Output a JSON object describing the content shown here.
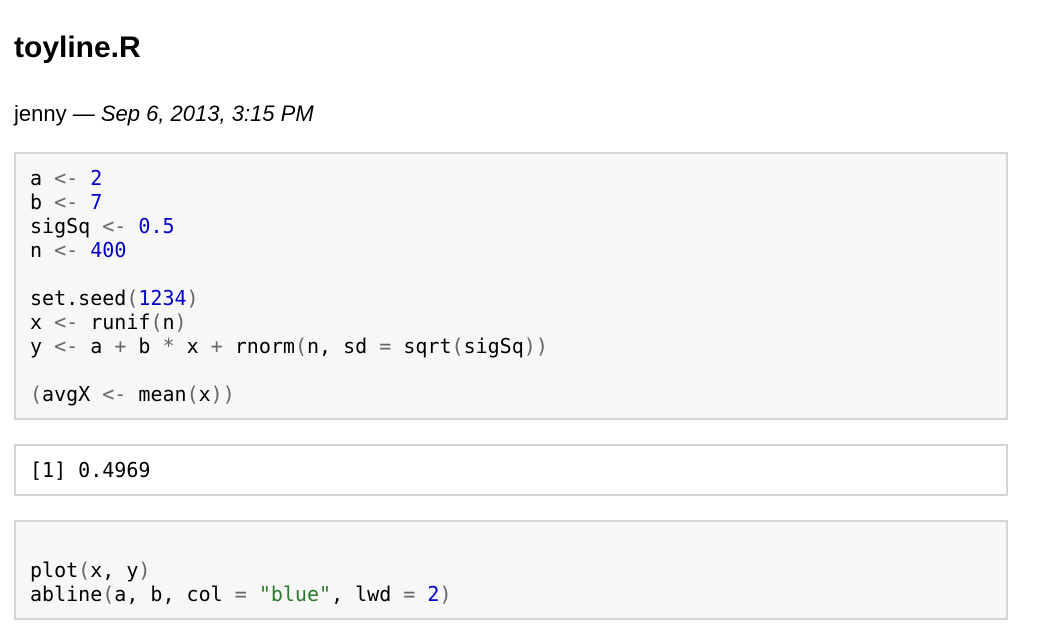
{
  "header": {
    "title": "toyline.R",
    "author": "jenny",
    "separator": " — ",
    "date": "Sep 6, 2013, 3:15 PM"
  },
  "chunk1": {
    "lines": [
      [
        {
          "t": "a",
          "c": "sym"
        },
        {
          "t": " ",
          "c": "sym"
        },
        {
          "t": "<-",
          "c": "op"
        },
        {
          "t": " ",
          "c": "sym"
        },
        {
          "t": "2",
          "c": "num"
        }
      ],
      [
        {
          "t": "b",
          "c": "sym"
        },
        {
          "t": " ",
          "c": "sym"
        },
        {
          "t": "<-",
          "c": "op"
        },
        {
          "t": " ",
          "c": "sym"
        },
        {
          "t": "7",
          "c": "num"
        }
      ],
      [
        {
          "t": "sigSq",
          "c": "sym"
        },
        {
          "t": " ",
          "c": "sym"
        },
        {
          "t": "<-",
          "c": "op"
        },
        {
          "t": " ",
          "c": "sym"
        },
        {
          "t": "0.5",
          "c": "num"
        }
      ],
      [
        {
          "t": "n",
          "c": "sym"
        },
        {
          "t": " ",
          "c": "sym"
        },
        {
          "t": "<-",
          "c": "op"
        },
        {
          "t": " ",
          "c": "sym"
        },
        {
          "t": "400",
          "c": "num"
        }
      ],
      [],
      [
        {
          "t": "set.seed",
          "c": "sym"
        },
        {
          "t": "(",
          "c": "par"
        },
        {
          "t": "1234",
          "c": "num"
        },
        {
          "t": ")",
          "c": "par"
        }
      ],
      [
        {
          "t": "x",
          "c": "sym"
        },
        {
          "t": " ",
          "c": "sym"
        },
        {
          "t": "<-",
          "c": "op"
        },
        {
          "t": " runif",
          "c": "sym"
        },
        {
          "t": "(",
          "c": "par"
        },
        {
          "t": "n",
          "c": "sym"
        },
        {
          "t": ")",
          "c": "par"
        }
      ],
      [
        {
          "t": "y",
          "c": "sym"
        },
        {
          "t": " ",
          "c": "sym"
        },
        {
          "t": "<-",
          "c": "op"
        },
        {
          "t": " a ",
          "c": "sym"
        },
        {
          "t": "+",
          "c": "op"
        },
        {
          "t": " b ",
          "c": "sym"
        },
        {
          "t": "*",
          "c": "op"
        },
        {
          "t": " x ",
          "c": "sym"
        },
        {
          "t": "+",
          "c": "op"
        },
        {
          "t": " rnorm",
          "c": "sym"
        },
        {
          "t": "(",
          "c": "par"
        },
        {
          "t": "n, sd ",
          "c": "sym"
        },
        {
          "t": "=",
          "c": "op"
        },
        {
          "t": " sqrt",
          "c": "sym"
        },
        {
          "t": "(",
          "c": "par"
        },
        {
          "t": "sigSq",
          "c": "sym"
        },
        {
          "t": "))",
          "c": "par"
        }
      ],
      [],
      [
        {
          "t": "(",
          "c": "par"
        },
        {
          "t": "avgX ",
          "c": "sym"
        },
        {
          "t": "<-",
          "c": "op"
        },
        {
          "t": " mean",
          "c": "sym"
        },
        {
          "t": "(",
          "c": "par"
        },
        {
          "t": "x",
          "c": "sym"
        },
        {
          "t": "))",
          "c": "par"
        }
      ]
    ]
  },
  "output1": {
    "text": "[1] 0.4969"
  },
  "chunk2": {
    "lines": [
      [],
      [
        {
          "t": "plot",
          "c": "sym"
        },
        {
          "t": "(",
          "c": "par"
        },
        {
          "t": "x, y",
          "c": "sym"
        },
        {
          "t": ")",
          "c": "par"
        }
      ],
      [
        {
          "t": "abline",
          "c": "sym"
        },
        {
          "t": "(",
          "c": "par"
        },
        {
          "t": "a, b, col ",
          "c": "sym"
        },
        {
          "t": "=",
          "c": "op"
        },
        {
          "t": " ",
          "c": "sym"
        },
        {
          "t": "\"blue\"",
          "c": "str"
        },
        {
          "t": ", lwd ",
          "c": "sym"
        },
        {
          "t": "=",
          "c": "op"
        },
        {
          "t": " ",
          "c": "sym"
        },
        {
          "t": "2",
          "c": "num"
        },
        {
          "t": ")",
          "c": "par"
        }
      ]
    ]
  }
}
